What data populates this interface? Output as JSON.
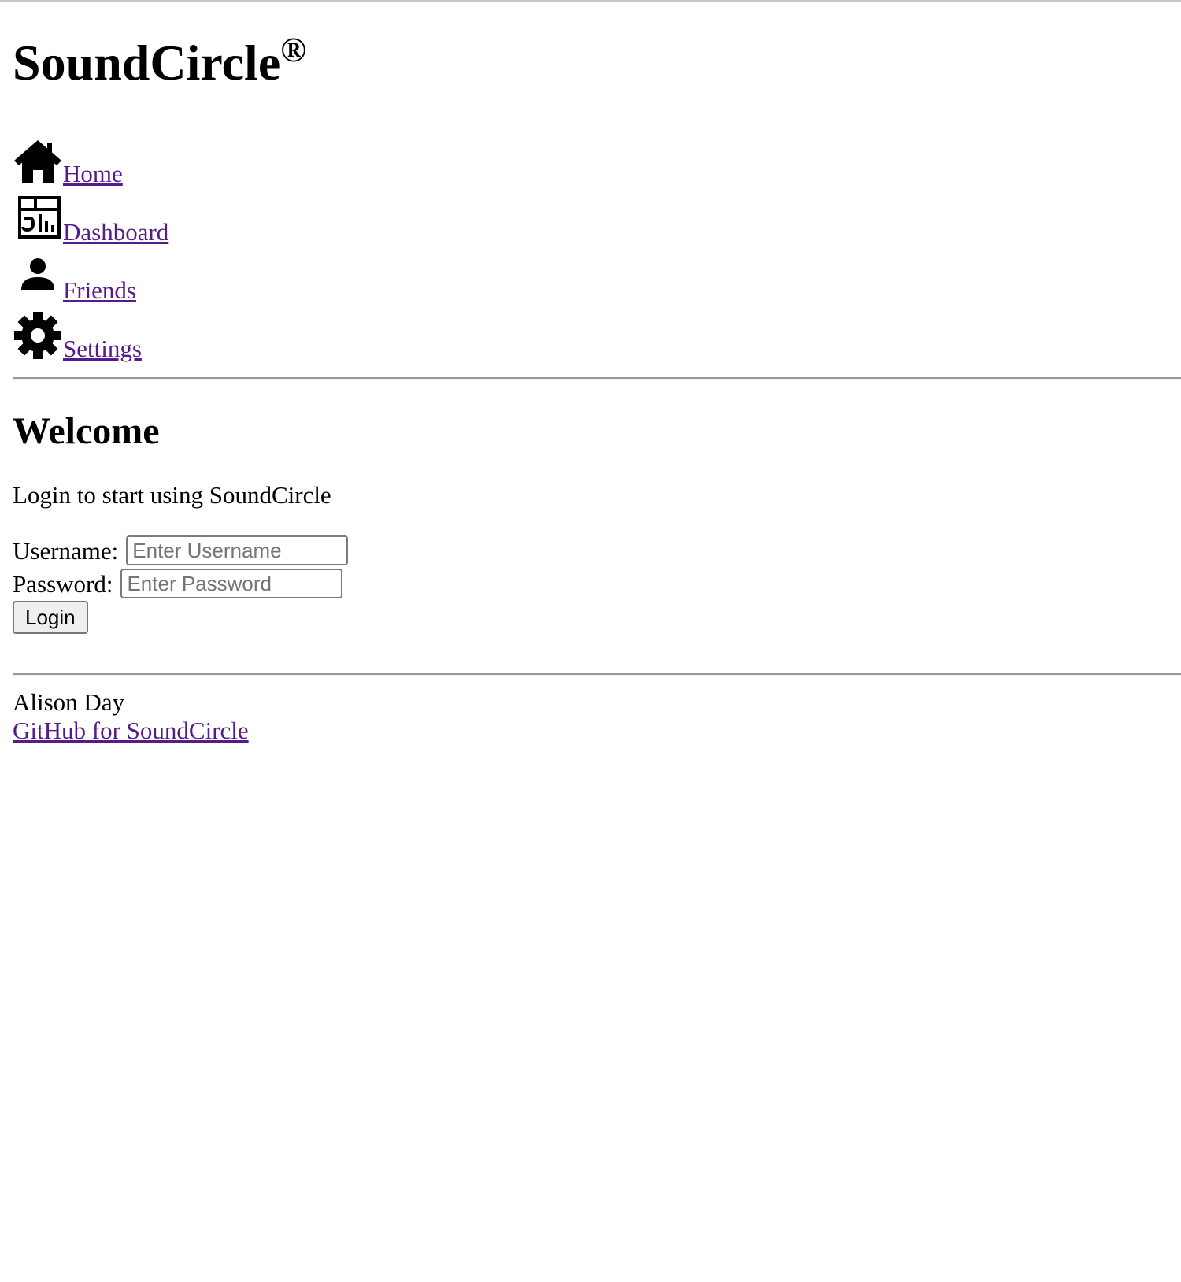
{
  "header": {
    "title": "SoundCircle",
    "registered_mark": "®"
  },
  "nav": {
    "items": [
      {
        "label": "Home",
        "icon": "home-icon"
      },
      {
        "label": " Dashboard",
        "icon": "dashboard-icon"
      },
      {
        "label": " Friends",
        "icon": "person-icon"
      },
      {
        "label": " Settings",
        "icon": "gear-icon"
      }
    ]
  },
  "main": {
    "heading": "Welcome",
    "intro": "Login to start using SoundCircle",
    "username_label": "Username:",
    "username_placeholder": "Enter Username",
    "password_label": "Password:",
    "password_placeholder": "Enter Password",
    "login_label": "Login"
  },
  "footer": {
    "author": "Alison Day",
    "github_link": "GitHub for SoundCircle"
  }
}
